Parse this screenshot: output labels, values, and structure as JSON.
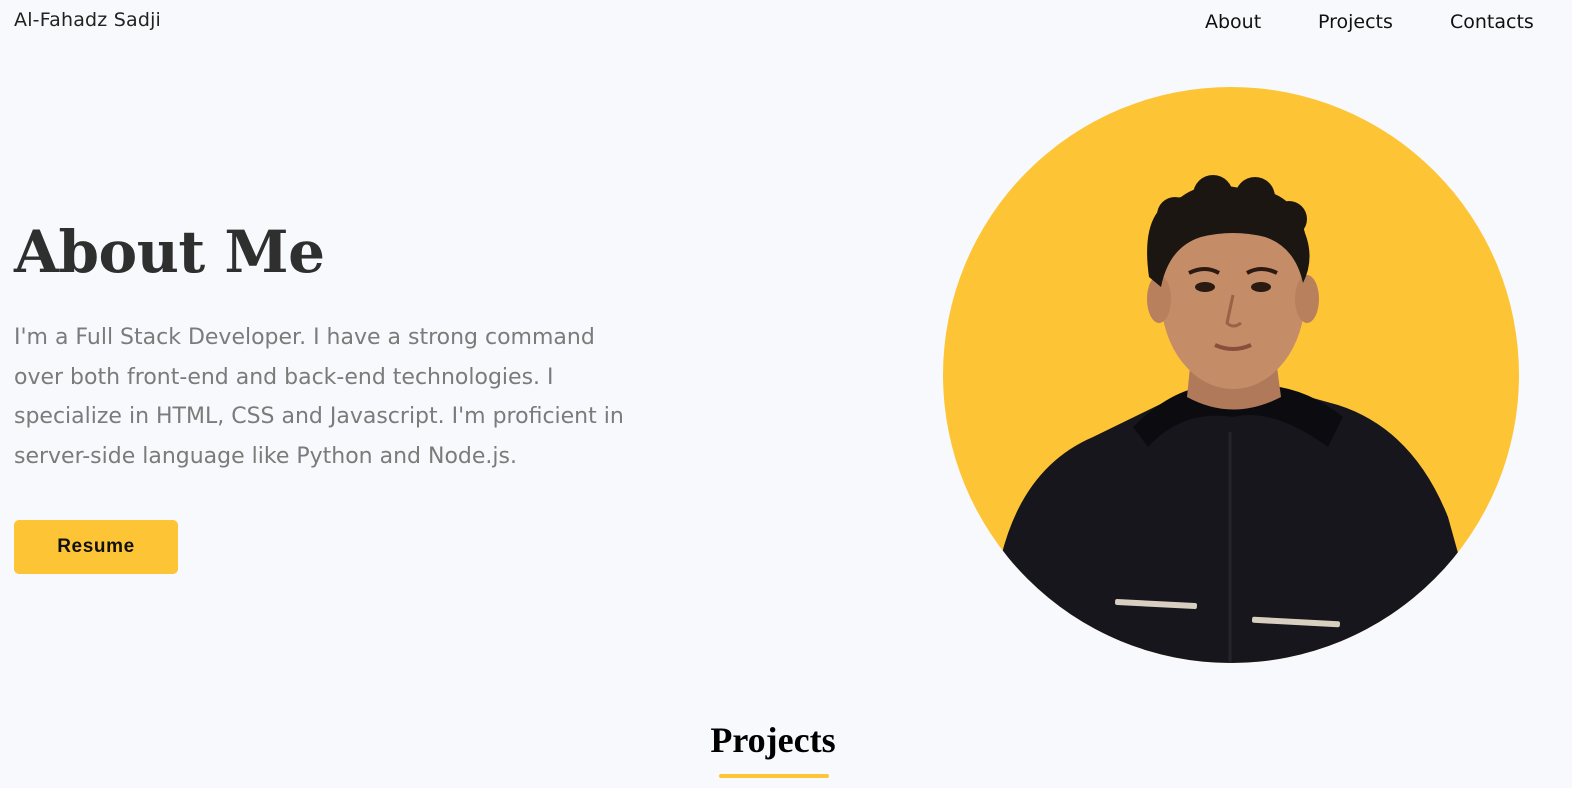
{
  "colors": {
    "background": "#f8f9fc",
    "accent": "#fdc535",
    "heading": "#2f2f2f",
    "body_text": "#7b7b7b"
  },
  "header": {
    "brand": "Al-Fahadz Sadji",
    "nav": {
      "about": "About",
      "projects": "Projects",
      "contacts": "Contacts"
    }
  },
  "about": {
    "title": "About Me",
    "description": "I'm a Full Stack Developer. I have a strong command\nover both front-end and back-end technologies. I\nspecialize in HTML, CSS and Javascript. I'm proficient in\nserver-side language like Python and Node.js.",
    "resume_label": "Resume",
    "portrait_icon": "profile-photo"
  },
  "projects": {
    "title": "Projects"
  }
}
